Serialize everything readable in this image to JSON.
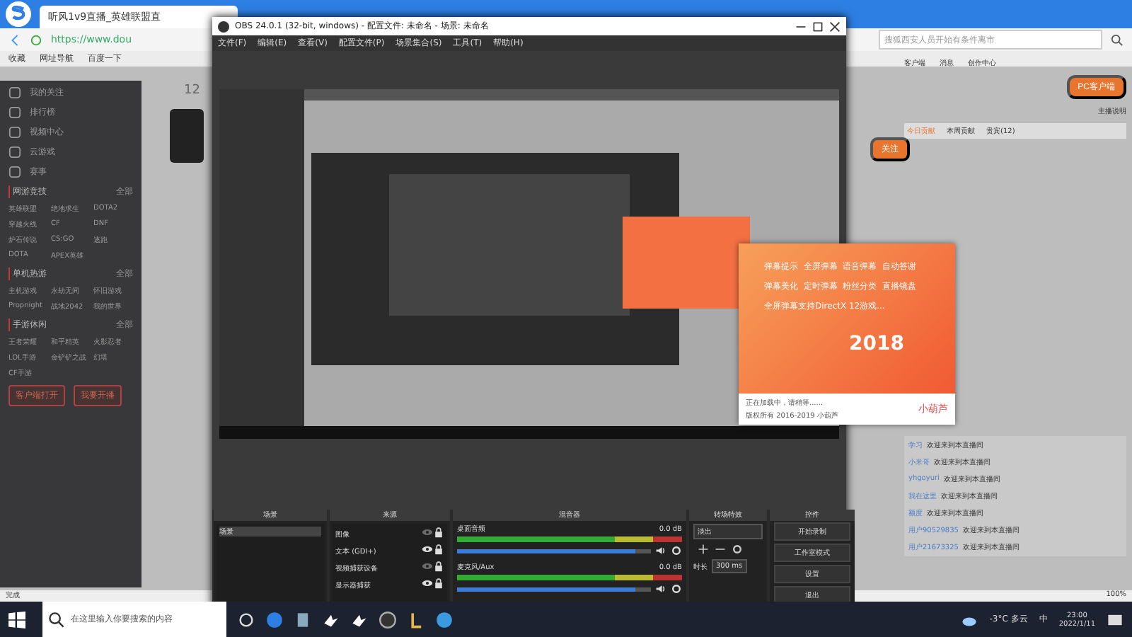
{
  "browser": {
    "tab_title": "听风1v9直播_英雄联盟直",
    "address": "https://www.dou",
    "search_placeholder": "搜狐西安人员开始有条件离市",
    "bookmarks": [
      "收藏",
      "网址导航",
      "百度一下"
    ],
    "status_left": "完成",
    "zoom": "100%"
  },
  "page": {
    "sidebar_nav": [
      "我的关注",
      "排行榜",
      "视频中心",
      "云游戏",
      "赛事"
    ],
    "sidebar_sections": [
      {
        "title": "网游竞技",
        "more": "全部",
        "games": [
          "英雄联盟",
          "绝地求生",
          "DOTA2",
          "穿越火线",
          "CF",
          "DNF",
          "炉石传说",
          "CS:GO",
          "逃跑",
          "DOTA",
          "APEX英雄"
        ]
      },
      {
        "title": "单机热游",
        "more": "全部",
        "games": [
          "主机游戏",
          "永劫无间",
          "怀旧游戏",
          "Propnight",
          "战地2042",
          "我的世界"
        ]
      },
      {
        "title": "手游休闲",
        "more": "全部",
        "games": [
          "王者荣耀",
          "和平精英",
          "火影忍者",
          "LOL手游",
          "金铲铲之战",
          "幻塔",
          "CF手游"
        ]
      }
    ],
    "sidebar_buttons": [
      "客户端打开",
      "我要开播"
    ],
    "header_links": [
      "客户端",
      "消息",
      "创作中心"
    ],
    "follow_count": "12",
    "follow_button": "关注",
    "client_button": "PC客户端",
    "client_note": "主播说明",
    "rank_tabs": [
      {
        "label": "今日贡献",
        "selected": true
      },
      {
        "label": "本周贡献",
        "selected": false
      },
      {
        "label": "贵宾(12)",
        "selected": false
      }
    ],
    "chat": [
      {
        "name": "学习",
        "text": "欢迎来到本直播间"
      },
      {
        "name": "小米哥",
        "text": "欢迎来到本直播间"
      },
      {
        "name": "yhgoyuri",
        "text": "欢迎来到本直播间"
      },
      {
        "name": "我在这里",
        "text": "欢迎来到本直播间"
      },
      {
        "name": "额度",
        "text": "欢迎来到本直播间"
      },
      {
        "name": "用户90529835",
        "text": "欢迎来到本直播间"
      },
      {
        "name": "用户21673325",
        "text": "欢迎来到本直播间"
      }
    ]
  },
  "obs": {
    "title": "OBS 24.0.1 (32-bit, windows) - 配置文件: 未命名 - 场景: 未命名",
    "menus": [
      "文件(F)",
      "编辑(E)",
      "查看(V)",
      "配置文件(P)",
      "场景集合(S)",
      "工具(T)",
      "帮助(H)"
    ],
    "docks": [
      "场景",
      "来源",
      "混音器",
      "转场特效",
      "控件"
    ],
    "scenes": [
      {
        "label": "场景",
        "selected": true
      }
    ],
    "sources": [
      {
        "label": "图像",
        "visible": false
      },
      {
        "label": "文本 (GDI+)",
        "visible": true
      },
      {
        "label": "视频捕获设备",
        "visible": false
      },
      {
        "label": "显示器捕获",
        "visible": true
      }
    ],
    "mixer": [
      {
        "name": "桌面音频",
        "reading": "0.0 dB",
        "level": 0.92
      },
      {
        "name": "麦克风/Aux",
        "reading": "0.0 dB",
        "level": 0.92
      }
    ],
    "transition": {
      "value": "淡出",
      "duration_label": "时长",
      "duration": "300 ms"
    },
    "controls": [
      "开始录制",
      "工作室模式",
      "设置",
      "退出"
    ]
  },
  "promo": {
    "lines": [
      "弹幕提示  全屏弹幕  语音弹幕  自动答谢",
      "弹幕美化  定时弹幕  粉丝分类  直播镜盘",
      "全屏弹幕支持DirectX 12游戏..."
    ],
    "year": "2018",
    "loading": "正在加载中，请稍等......",
    "copyright": "版权所有  2016-2019 小葫芦",
    "brand": "小葫芦"
  },
  "taskbar": {
    "search_placeholder": "在这里输入你要搜索的内容",
    "weather": "-3°C 多云",
    "ime": "中",
    "time": "23:00",
    "date": "2022/1/11"
  }
}
